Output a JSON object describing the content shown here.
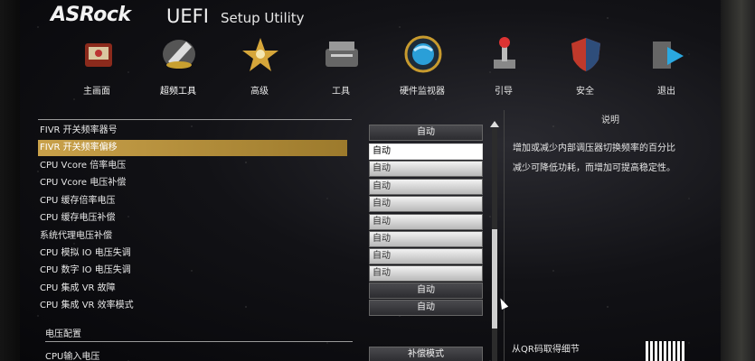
{
  "header": {
    "brand": "ASRock",
    "uefi": "UEFI",
    "setup": "Setup Utility"
  },
  "nav": [
    {
      "label": "主画面",
      "icon": "home-icon"
    },
    {
      "label": "超频工具",
      "icon": "oc-tweaker-icon",
      "active": true
    },
    {
      "label": "高级",
      "icon": "advanced-icon"
    },
    {
      "label": "工具",
      "icon": "tool-icon"
    },
    {
      "label": "硬件监视器",
      "icon": "hardware-monitor-icon"
    },
    {
      "label": "引导",
      "icon": "boot-icon"
    },
    {
      "label": "安全",
      "icon": "security-icon"
    },
    {
      "label": "退出",
      "icon": "exit-icon"
    }
  ],
  "settings": [
    {
      "label": "FIVR 开关频率器号",
      "value": "自动"
    },
    {
      "label": "FIVR 开关频率偏移",
      "value": "自动",
      "selected": true
    },
    {
      "label": "CPU Vcore 倍率电压",
      "value": "自动"
    },
    {
      "label": "CPU Vcore 电压补偿",
      "value": "自动"
    },
    {
      "label": "CPU 缓存倍率电压",
      "value": "自动"
    },
    {
      "label": "CPU 缓存电压补偿",
      "value": "自动"
    },
    {
      "label": "系统代理电压补偿",
      "value": "自动"
    },
    {
      "label": "CPU 模拟 IO 电压失调",
      "value": "自动"
    },
    {
      "label": "CPU 数字 IO 电压失调",
      "value": "自动"
    },
    {
      "label": "CPU 集成 VR 故障",
      "value": "自动"
    },
    {
      "label": "CPU 集成 VR 效率模式",
      "value": "自动"
    }
  ],
  "voltage_section": {
    "title": "电压配置",
    "first_label": "CPU输入电压",
    "first_value": "补偿模式"
  },
  "help": {
    "title": "说明",
    "line1": "增加或减少内部调压器切换频率的百分比",
    "line2": "减少可降低功耗，而增加可提高稳定性。",
    "qr_label": "从QR码取得细节"
  }
}
